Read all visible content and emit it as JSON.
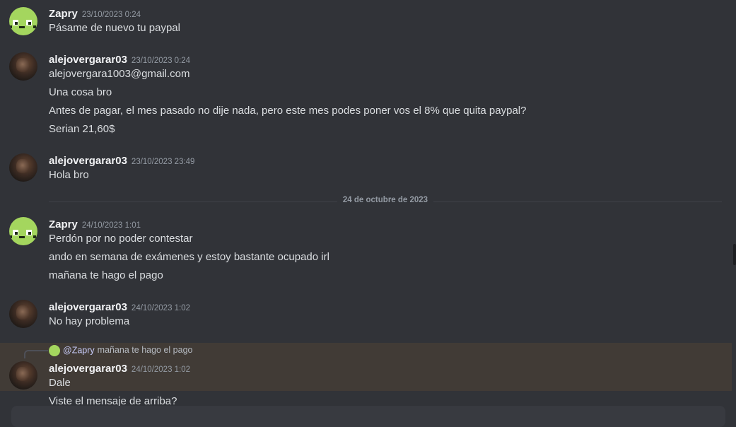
{
  "messages": [
    {
      "author": "Zapry",
      "timestamp": "23/10/2023 0:24",
      "lines": [
        "Pásame de nuevo tu paypal"
      ]
    },
    {
      "author": "alejovergarar03",
      "timestamp": "23/10/2023 0:24",
      "lines": [
        "alejovergara1003@gmail.com",
        "Una cosa bro",
        "Antes de pagar, el mes pasado no dije nada, pero este mes podes poner vos el 8% que quita paypal?",
        "Serian 21,60$"
      ]
    },
    {
      "author": "alejovergarar03",
      "timestamp": "23/10/2023 23:49",
      "lines": [
        "Hola bro"
      ]
    },
    {
      "author": "Zapry",
      "timestamp": "24/10/2023 1:01",
      "lines": [
        "Perdón por no poder contestar",
        "ando en semana de exámenes y estoy bastante ocupado irl",
        "mañana te hago el pago"
      ]
    },
    {
      "author": "alejovergarar03",
      "timestamp": "24/10/2023 1:02",
      "lines": [
        "No hay problema"
      ]
    },
    {
      "author": "alejovergarar03",
      "timestamp": "24/10/2023 1:02",
      "lines": [
        "Dale",
        "Viste el mensaje de arriba?"
      ]
    }
  ],
  "date_divider": "24 de octubre de 2023",
  "reply": {
    "mention": "@Zapry",
    "text": "mañana te hago el pago"
  },
  "colors": {
    "background": "#313338",
    "highlight": "#413b36",
    "bot_avatar": "#a4d65e"
  },
  "icons": {
    "bot_avatar": "pixel-face-icon",
    "user_avatar": "user-photo-avatar"
  }
}
